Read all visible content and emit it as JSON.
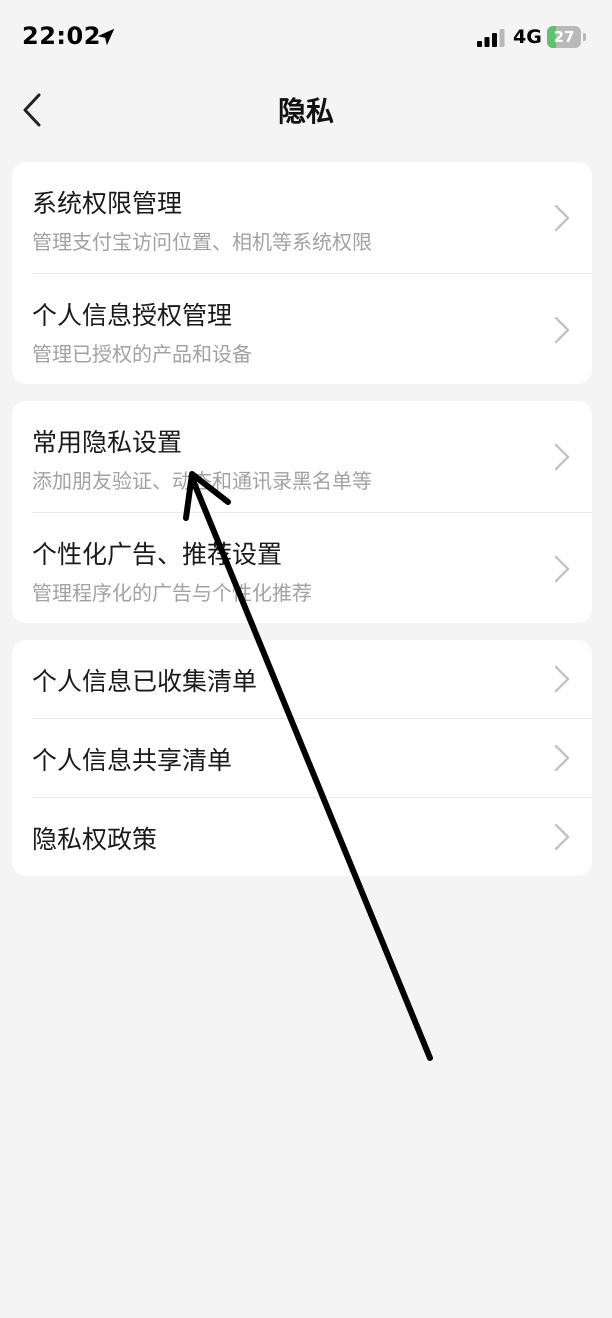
{
  "status": {
    "time": "22:02",
    "network": "4G",
    "battery": "27",
    "battery_level": 0.27
  },
  "nav": {
    "title": "隐私"
  },
  "groups": [
    {
      "rows": [
        {
          "title": "系统权限管理",
          "subtitle": "管理支付宝访问位置、相机等系统权限"
        },
        {
          "title": "个人信息授权管理",
          "subtitle": "管理已授权的产品和设备"
        }
      ]
    },
    {
      "rows": [
        {
          "title": "常用隐私设置",
          "subtitle": "添加朋友验证、动态和通讯录黑名单等"
        },
        {
          "title": "个性化广告、推荐设置",
          "subtitle": "管理程序化的广告与个性化推荐"
        }
      ]
    },
    {
      "rows": [
        {
          "title": "个人信息已收集清单"
        },
        {
          "title": "个人信息共享清单"
        },
        {
          "title": "隐私权政策"
        }
      ]
    }
  ],
  "icons": {
    "back": "chevron-left-icon",
    "row_arrow": "chevron-right-icon",
    "location": "location-arrow-icon",
    "signal": "signal-icon",
    "battery": "battery-charging-icon"
  }
}
